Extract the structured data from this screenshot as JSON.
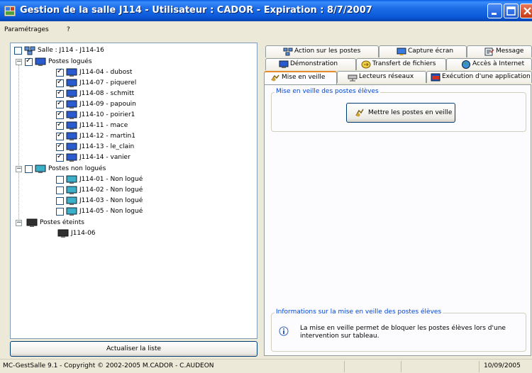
{
  "window": {
    "title": "Gestion de la salle J114 - Utilisateur : CADOR - Expiration  : 8/7/2007"
  },
  "menu": {
    "items": [
      "Paramétrages",
      "?"
    ]
  },
  "tree": {
    "root_label": "Salle : J114 - J114-16",
    "groups": [
      {
        "label": "Postes logués",
        "items": [
          "J114-04 - dubost",
          "J114-07 - piquerel",
          "J114-08 - schmitt",
          "J114-09 - papouin",
          "J114-10 - poirier1",
          "J114-11 - mace",
          "J114-12 - martin1",
          "J114-13 - le_clain",
          "J114-14 - vanier"
        ]
      },
      {
        "label": "Postes non logués",
        "items": [
          "J114-01 - Non logué",
          "J114-02 - Non logué",
          "J114-03 - Non logué",
          "J114-05 - Non logué"
        ]
      },
      {
        "label": "Postes éteints",
        "items": [
          "J114-06"
        ]
      }
    ]
  },
  "update_button": "Actualiser la liste",
  "tabs": {
    "row1": [
      "Action sur les postes",
      "Capture écran",
      "Message"
    ],
    "row2": [
      "Démonstration",
      "Transfert de fichiers",
      "Accès à Internet"
    ],
    "row3": [
      "Mise en veille",
      "Lecteurs réseaux",
      "Exécution d'une application"
    ],
    "active": "Mise en veille"
  },
  "content": {
    "group1_title": "Mise en veille des postes élèves",
    "sleep_button": "Mettre les postes en veille",
    "group2_title": "Informations sur la mise en veille des postes élèves",
    "info_line1": "La mise en veille permet de bloquer les postes élèves lors d'une",
    "info_line2": "intervention sur tableau."
  },
  "status": {
    "copyright": "MC-GestSalle 9.1 - Copyright © 2002-2005  M.CADOR - C.AUDEON",
    "date": "10/09/2005"
  },
  "colors": {
    "titlebar": "#0a58d8",
    "group_title": "#0046d5",
    "active_tab_accent": "#e68b2c"
  }
}
